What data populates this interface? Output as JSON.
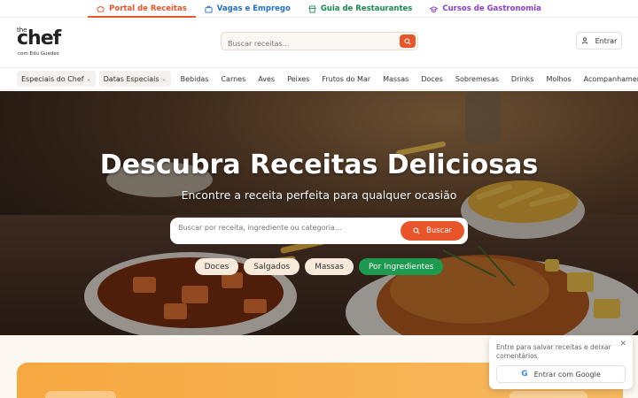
{
  "topnav": {
    "tabs": [
      {
        "label": "Portal de Receitas",
        "icon": "chef-hat-icon",
        "color": "#e8552a",
        "active": true
      },
      {
        "label": "Vagas e Emprego",
        "icon": "briefcase-icon",
        "color": "#1e6fc8"
      },
      {
        "label": "Guia de Restaurantes",
        "icon": "store-icon",
        "color": "#178a4c"
      },
      {
        "label": "Cursos de Gastronomia",
        "icon": "graduation-cap-icon",
        "color": "#8a3fc8"
      }
    ]
  },
  "header": {
    "logo_top": "the",
    "logo_main": "chef",
    "logo_sub": "com Edu Guedes",
    "search_placeholder": "Buscar receitas...",
    "login_label": "Entrar"
  },
  "categories": [
    {
      "label": "Especiais do Chef",
      "dropdown": true
    },
    {
      "label": "Datas Especiais",
      "dropdown": true
    },
    {
      "label": "Bebidas"
    },
    {
      "label": "Carnes"
    },
    {
      "label": "Aves"
    },
    {
      "label": "Peixes"
    },
    {
      "label": "Frutos do Mar"
    },
    {
      "label": "Massas"
    },
    {
      "label": "Doces"
    },
    {
      "label": "Sobremesas"
    },
    {
      "label": "Drinks"
    },
    {
      "label": "Molhos"
    },
    {
      "label": "Acompanhamentos"
    }
  ],
  "hero": {
    "title": "Descubra Receitas Deliciosas",
    "subtitle": "Encontre a receita perfeita para qualquer ocasião",
    "search_placeholder": "Buscar por receita, ingrediente ou categoria...",
    "search_button": "Buscar",
    "chips": [
      {
        "label": "Doces"
      },
      {
        "label": "Salgados"
      },
      {
        "label": "Massas"
      },
      {
        "label": "Por Ingredientes",
        "highlight": true
      }
    ]
  },
  "popup": {
    "message": "Entre para salvar receitas e deixar comentários",
    "google_button": "Entrar com Google",
    "google_letter": "G"
  },
  "colors": {
    "accent": "#e8552a",
    "green": "#1d9a4f"
  }
}
